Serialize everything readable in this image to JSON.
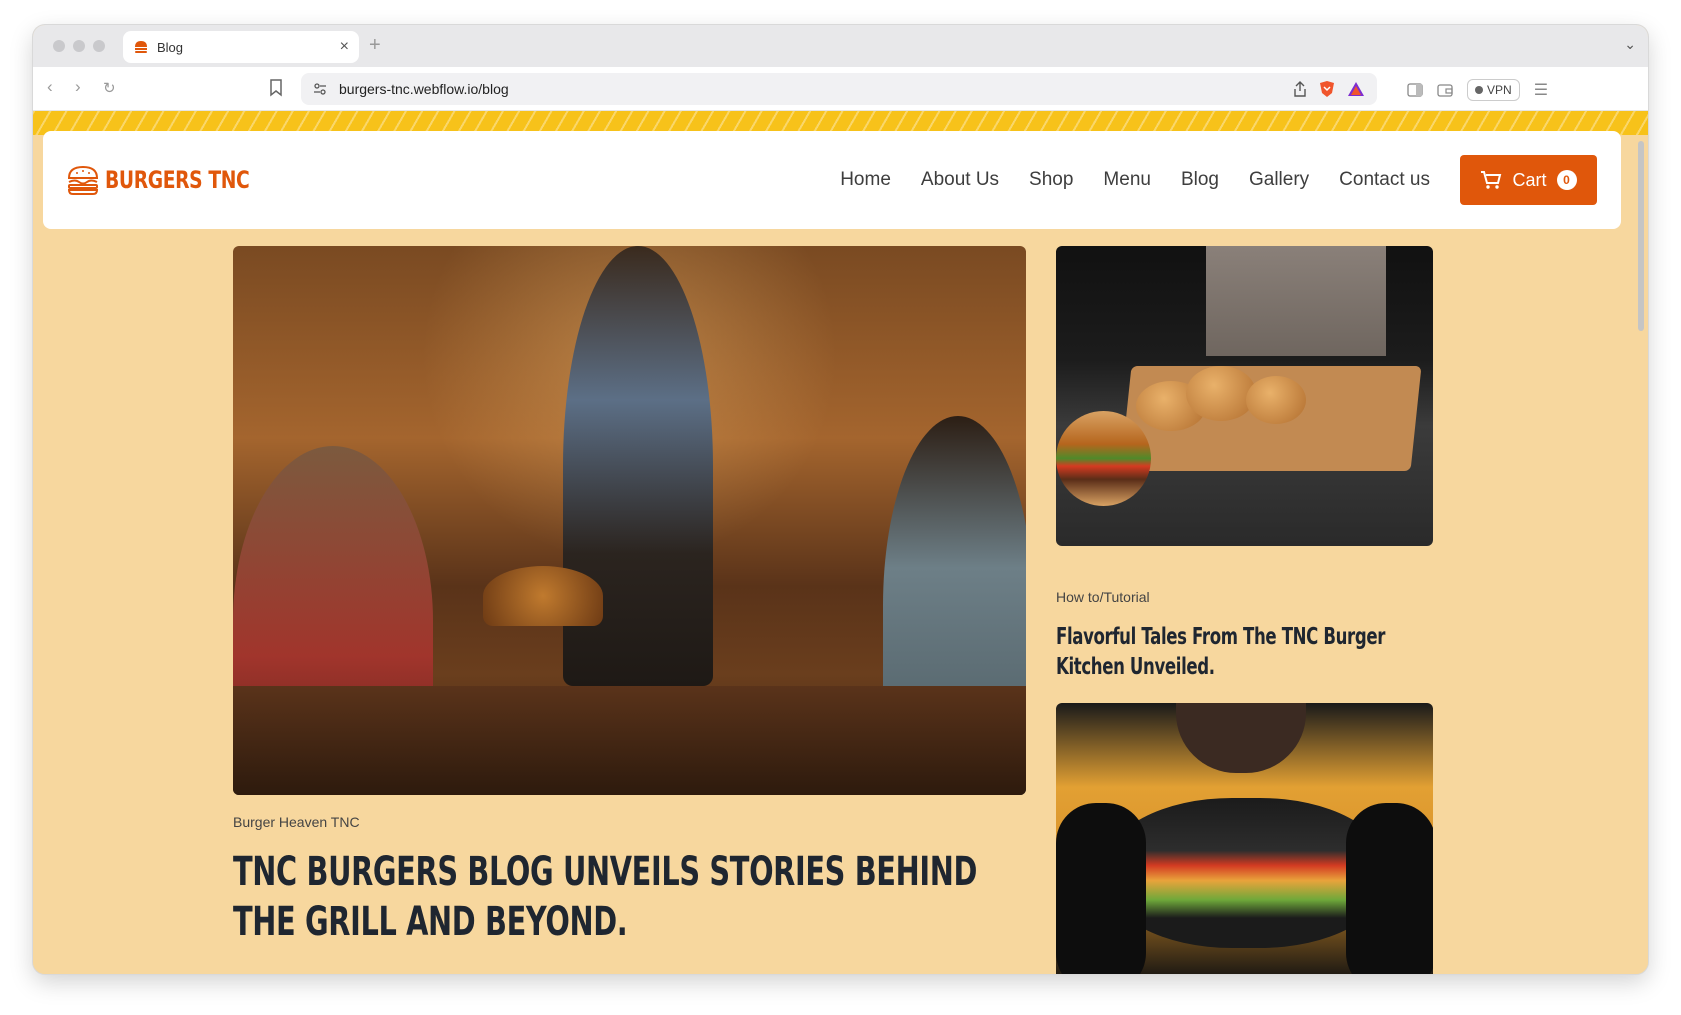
{
  "browser": {
    "tab_title": "Blog",
    "url": "burgers-tnc.webflow.io/blog",
    "vpn_label": "VPN"
  },
  "site": {
    "logo_text": "BURGERS TNC",
    "nav": [
      "Home",
      "About Us",
      "Shop",
      "Menu",
      "Blog",
      "Gallery",
      "Contact us"
    ],
    "cart_label": "Cart",
    "cart_count": "0",
    "accent_color": "#e0570b",
    "background_color": "#f7d79e"
  },
  "posts": {
    "featured": {
      "category": "Burger Heaven TNC",
      "title": "TNC Burgers Blog Unveils Stories Behind The Grill And Beyond.",
      "image": "restaurant-waiter-serving-burgers"
    },
    "side1": {
      "category": "How to/Tutorial",
      "title": "Flavorful Tales From The TNC Burger Kitchen Unveiled.",
      "image": "chef-cutting-burger-buns"
    },
    "side2": {
      "image": "man-holding-black-bun-burger"
    }
  }
}
